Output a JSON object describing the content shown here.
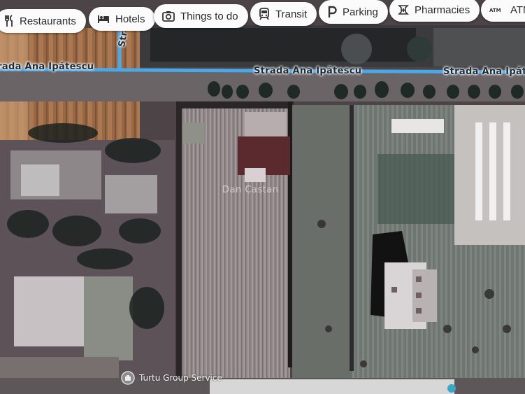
{
  "filter_chips": [
    {
      "label": "Restaurants",
      "icon": "fork-knife-icon"
    },
    {
      "label": "Hotels",
      "icon": "bed-icon"
    },
    {
      "label": "Things to do",
      "icon": "camera-icon"
    },
    {
      "label": "Transit",
      "icon": "train-icon"
    },
    {
      "label": "Parking",
      "icon": "parking-p-icon"
    },
    {
      "label": "Pharmacies",
      "icon": "pharmacy-cross-icon"
    },
    {
      "label": "ATMs",
      "icon": "atm-icon"
    }
  ],
  "map": {
    "view": "satellite",
    "road_color": "#4aa8e8",
    "streets": [
      {
        "label": "Strada Ana Ipătescu"
      },
      {
        "label": "Strada Ana Ipătescu"
      },
      {
        "label": "Strada Ana Ipătescu"
      },
      {
        "label": "Str"
      }
    ],
    "place_label": "Dan Castan",
    "poi_label": "Turtu Group Service",
    "poi_icon": "business-pin-icon"
  }
}
